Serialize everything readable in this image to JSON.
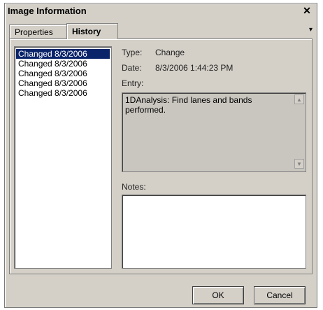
{
  "window": {
    "title": "Image Information",
    "close_glyph": "✕"
  },
  "tabs": [
    {
      "label": "Properties",
      "active": false
    },
    {
      "label": "History",
      "active": true
    }
  ],
  "tab_menu_glyph": "▾",
  "history_list": [
    {
      "label": "Changed 8/3/2006",
      "selected": true
    },
    {
      "label": "Changed 8/3/2006",
      "selected": false
    },
    {
      "label": "Changed 8/3/2006",
      "selected": false
    },
    {
      "label": "Changed 8/3/2006",
      "selected": false
    },
    {
      "label": "Changed 8/3/2006",
      "selected": false
    }
  ],
  "details": {
    "type_label": "Type:",
    "type_value": "Change",
    "date_label": "Date:",
    "date_value": "8/3/2006 1:44:23 PM",
    "entry_label": "Entry:",
    "entry_text": "1DAnalysis: Find lanes and bands performed.",
    "notes_label": "Notes:",
    "notes_text": ""
  },
  "buttons": {
    "ok": "OK",
    "cancel": "Cancel"
  },
  "colors": {
    "dialog_bg": "#d4d0c8",
    "selection": "#0a246a",
    "entry_bg": "#c9c6bf"
  }
}
